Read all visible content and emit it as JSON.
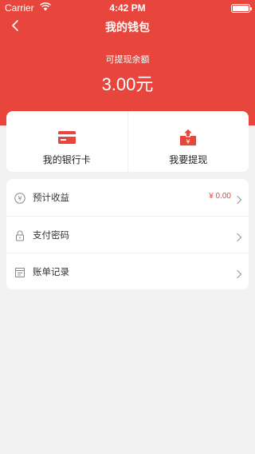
{
  "status_bar": {
    "carrier": "Carrier",
    "time": "4:42 PM"
  },
  "nav": {
    "title": "我的钱包"
  },
  "balance": {
    "label": "可提现余额",
    "amount": "3.00",
    "unit": "元"
  },
  "actions": [
    {
      "label": "我的银行卡",
      "icon": "bank-card-icon"
    },
    {
      "label": "我要提现",
      "icon": "withdraw-icon"
    }
  ],
  "list": [
    {
      "label": "预计收益",
      "value": "¥ 0.00",
      "icon": "yuan-coin-icon"
    },
    {
      "label": "支付密码",
      "icon": "lock-icon"
    },
    {
      "label": "账单记录",
      "icon": "bill-icon"
    }
  ],
  "colors": {
    "accent": "#e8463c",
    "background": "#f2f2f2"
  }
}
